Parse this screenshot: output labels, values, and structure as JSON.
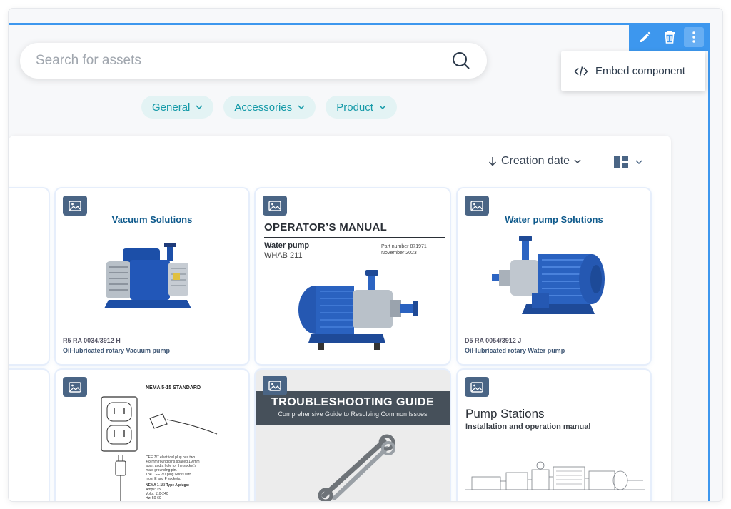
{
  "search": {
    "placeholder": "Search for assets"
  },
  "toolbar": {
    "edit_icon": "pencil-icon",
    "delete_icon": "trash-icon",
    "more_icon": "kebab-menu-icon"
  },
  "menu": {
    "embed_label": "Embed component",
    "embed_icon": "code-icon"
  },
  "filters": [
    {
      "label": "General"
    },
    {
      "label": "Accessories"
    },
    {
      "label": "Product"
    }
  ],
  "sort": {
    "label": "Creation date"
  },
  "cards": {
    "vacuum": {
      "title": "Vacuum Solutions",
      "code": "R5 RA 0034/3912 H",
      "subtitle": "Oil-lubricated rotary Vacuum pump"
    },
    "manual": {
      "title": "OPERATOR’S MANUAL",
      "product": "Water pump",
      "model": "WHAB 211",
      "part": "Part number 871971",
      "date": "November 2023"
    },
    "waterpump": {
      "title": "Water pump Solutions",
      "code": "D5 RA 0054/3912 J",
      "subtitle": "Oil-lubricated rotary Water pump"
    },
    "nema": {
      "title": "NEMA 5-15 STANDARD",
      "desc1": "CEE 7/7 electrical plug has two",
      "desc2": "4.8 mm round pins spaced 19 mm",
      "desc3": "apart and a hole for the socket's",
      "desc4": "male grounding pin.",
      "desc5": "The CEE 7/7 plug works with",
      "desc6": "most E and F sockets.",
      "spec_title": "NEMA 1-15/ Type A plugs:",
      "spec1": "Amps: 15",
      "spec2": "Volts: 110-240",
      "spec3": "Hz: 50-60"
    },
    "trouble": {
      "title": "TROUBLESHOOTING GUIDE",
      "subtitle": "Comprehensive Guide to Resolving Common Issues"
    },
    "stations": {
      "title": "Pump Stations",
      "subtitle": "Installation and operation manual"
    }
  },
  "colors": {
    "accent": "#3d97ee",
    "chip_bg": "#e3f3f4",
    "chip_text": "#159aa8",
    "badge": "#4a6585"
  }
}
